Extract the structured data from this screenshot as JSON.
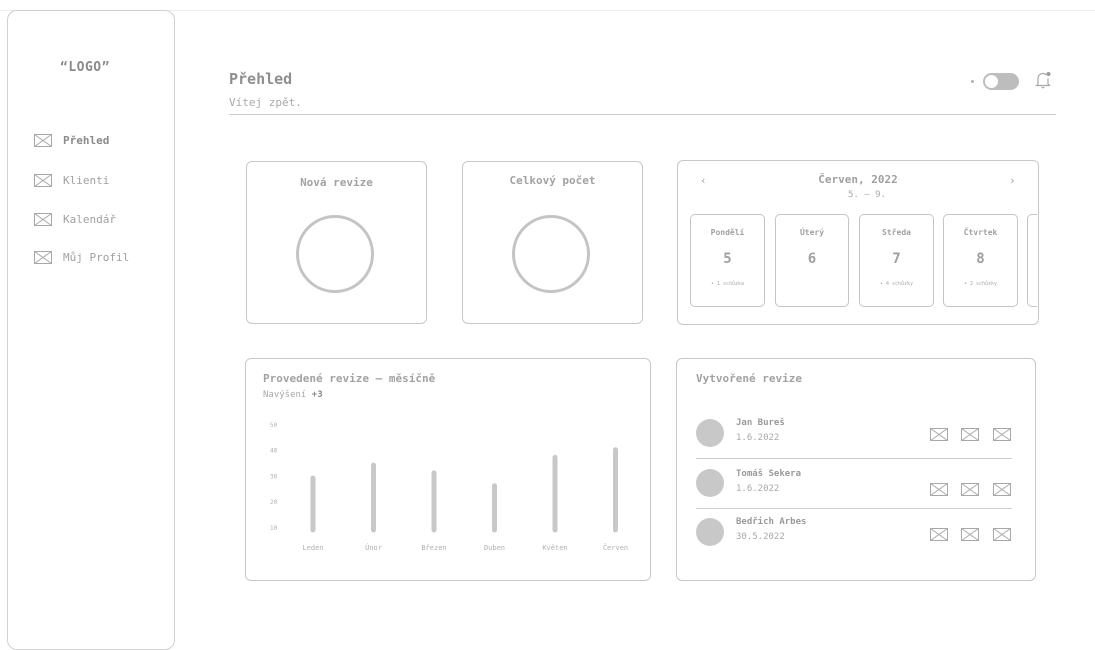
{
  "app": {
    "logo": "“LOGO”"
  },
  "sidebar": {
    "items": [
      {
        "label": "Přehled",
        "icon": "envelope-icon",
        "active": true
      },
      {
        "label": "Klienti",
        "icon": "envelope-icon",
        "active": false
      },
      {
        "label": "Kalendář",
        "icon": "envelope-icon",
        "active": false
      },
      {
        "label": "Můj Profil",
        "icon": "envelope-icon",
        "active": false
      }
    ]
  },
  "header": {
    "title": "Přehled",
    "subtitle": "Vítej zpět.",
    "toggle": {
      "on": false
    },
    "notification_icon": "bell-icon"
  },
  "stats": [
    {
      "title": "Nová revize"
    },
    {
      "title": "Celkový počet"
    }
  ],
  "calendar": {
    "month": "Červen, 2022",
    "range": "5. – 9.",
    "prev": "‹",
    "next": "›",
    "days": [
      {
        "name": "Pondělí",
        "number": "5",
        "meetings": "• 1 schůzka"
      },
      {
        "name": "Úterý",
        "number": "6",
        "meetings": ""
      },
      {
        "name": "Středa",
        "number": "7",
        "meetings": "• 4 schůzky"
      },
      {
        "name": "Čtvrtek",
        "number": "8",
        "meetings": "• 2 schůzky"
      }
    ]
  },
  "monthly_chart": {
    "title": "Provedené revize – měsíčně",
    "increase_label": "Navýšení",
    "increase_value": "+3"
  },
  "chart_data": {
    "type": "bar",
    "categories": [
      "Leden",
      "Únor",
      "Březen",
      "Duben",
      "Květen",
      "Červen"
    ],
    "values": [
      29,
      34,
      31,
      26,
      37,
      40
    ],
    "yticks": [
      10,
      20,
      30,
      40,
      50
    ],
    "ylim": [
      8,
      50
    ],
    "color": "#c8c8c8"
  },
  "created_list": {
    "title": "Vytvořené revize",
    "items": [
      {
        "name": "Jan Bureš",
        "date": "1.6.2022"
      },
      {
        "name": "Tomáš Sekera",
        "date": "1.6.2022"
      },
      {
        "name": "Bedřich Arbes",
        "date": "30.5.2022"
      }
    ],
    "action_icons": [
      "envelope-icon",
      "envelope-icon",
      "envelope-icon"
    ]
  }
}
